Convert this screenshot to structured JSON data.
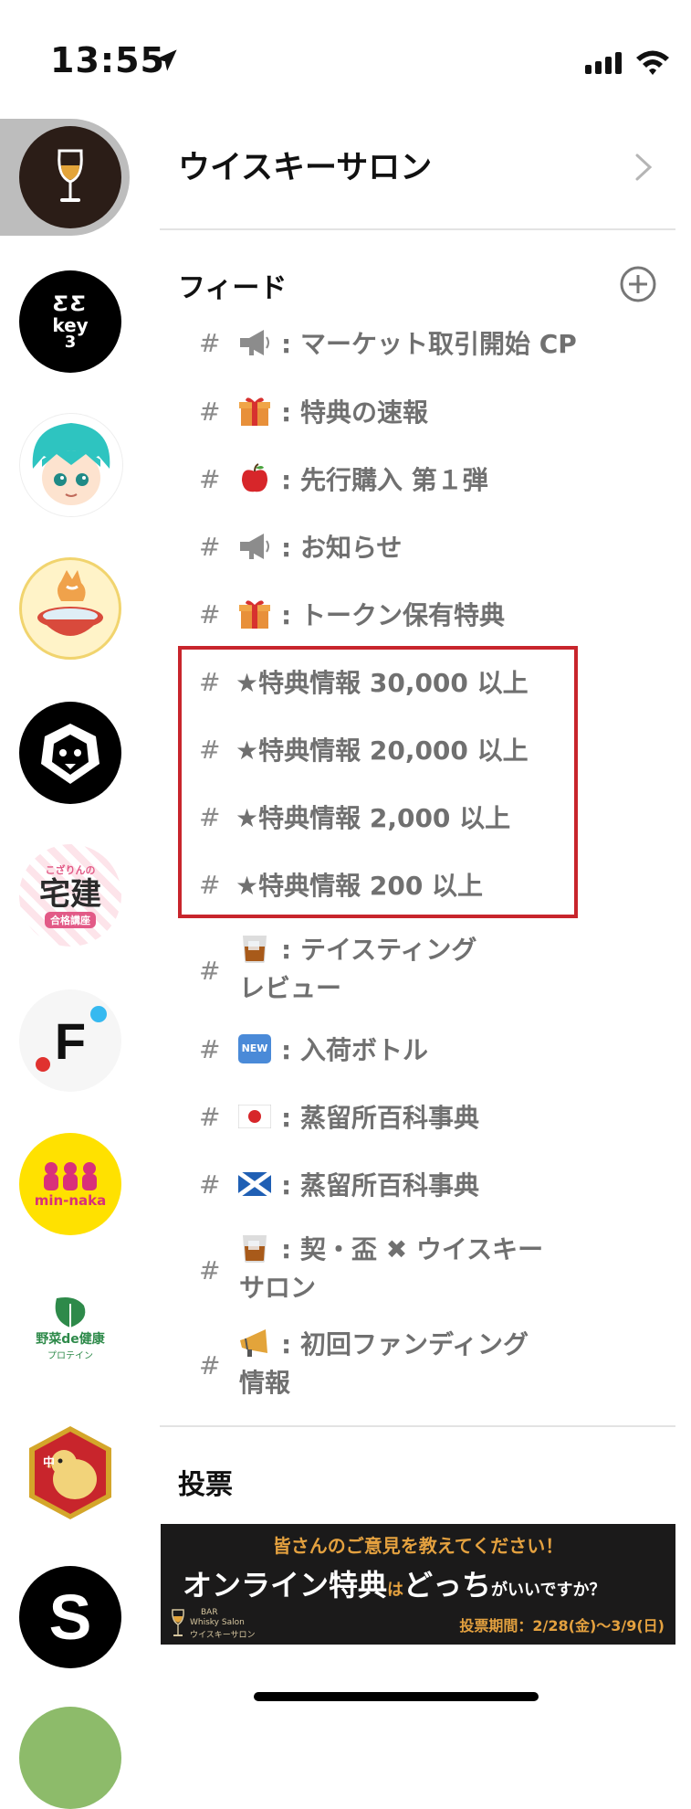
{
  "status_bar": {
    "time": "13:55"
  },
  "server_name": "ウイスキーサロン",
  "feed": {
    "title": "フィード",
    "channels": [
      {
        "emoji": "loudspeaker-icon",
        "label": ": マーケット取引開始 CP"
      },
      {
        "emoji": "gift-icon",
        "label": ": 特典の速報"
      },
      {
        "emoji": "apple-icon",
        "label": ": 先行購入 第１弾"
      },
      {
        "emoji": "loudspeaker-icon",
        "label": ": お知らせ"
      },
      {
        "emoji": "gift-icon",
        "label": ": トークン保有特典"
      },
      {
        "label": "★特典情報 30,000 以上"
      },
      {
        "label": "★特典情報 20,000 以上"
      },
      {
        "label": "★特典情報 2,000 以上"
      },
      {
        "label": "★特典情報 200 以上"
      },
      {
        "emoji": "whisky-glass-icon",
        "label1": ": テイスティング",
        "label2": "レビュー"
      },
      {
        "emoji": "new-icon",
        "emoji_text": "NEW",
        "label": ": 入荷ボトル"
      },
      {
        "emoji": "japan-flag-icon",
        "label": ": 蒸留所百科事典"
      },
      {
        "emoji": "scotland-flag-icon",
        "label": ": 蒸留所百科事典"
      },
      {
        "emoji": "whisky-glass-icon",
        "label1": ": 契・盃 ✖ ウイスキー",
        "label2": "サロン"
      },
      {
        "emoji": "megaphone-icon",
        "label1": ": 初回ファンディング",
        "label2": "情報"
      }
    ]
  },
  "vote": {
    "title": "投票",
    "banner": {
      "top": "皆さんのご意見を教えてください！",
      "main_a": "オンライン特典",
      "main_b": "は",
      "main_c": "どっち",
      "main_d": "がいいですか？",
      "logo_line1": "BAR",
      "logo_line2": "Whisky Salon",
      "logo_line3": "ウイスキーサロン",
      "period": "投票期間：2/28(金)〜3/9(日)"
    }
  },
  "rail": {
    "key_text": "key",
    "key_num": "3",
    "takken_top": "こざりんの",
    "takken_main": "宅建",
    "takken_badge": "合格講座",
    "fnc_letter": "F",
    "minnaka_text": "min-naka",
    "yasai_main": "野菜de健康",
    "yasai_sub": "プロテイン",
    "chick_mark": "中",
    "s_letter": "S"
  },
  "colors": {
    "highlight": "#c8252c",
    "muted": "#707070",
    "banner_accent": "#e4a13f"
  }
}
